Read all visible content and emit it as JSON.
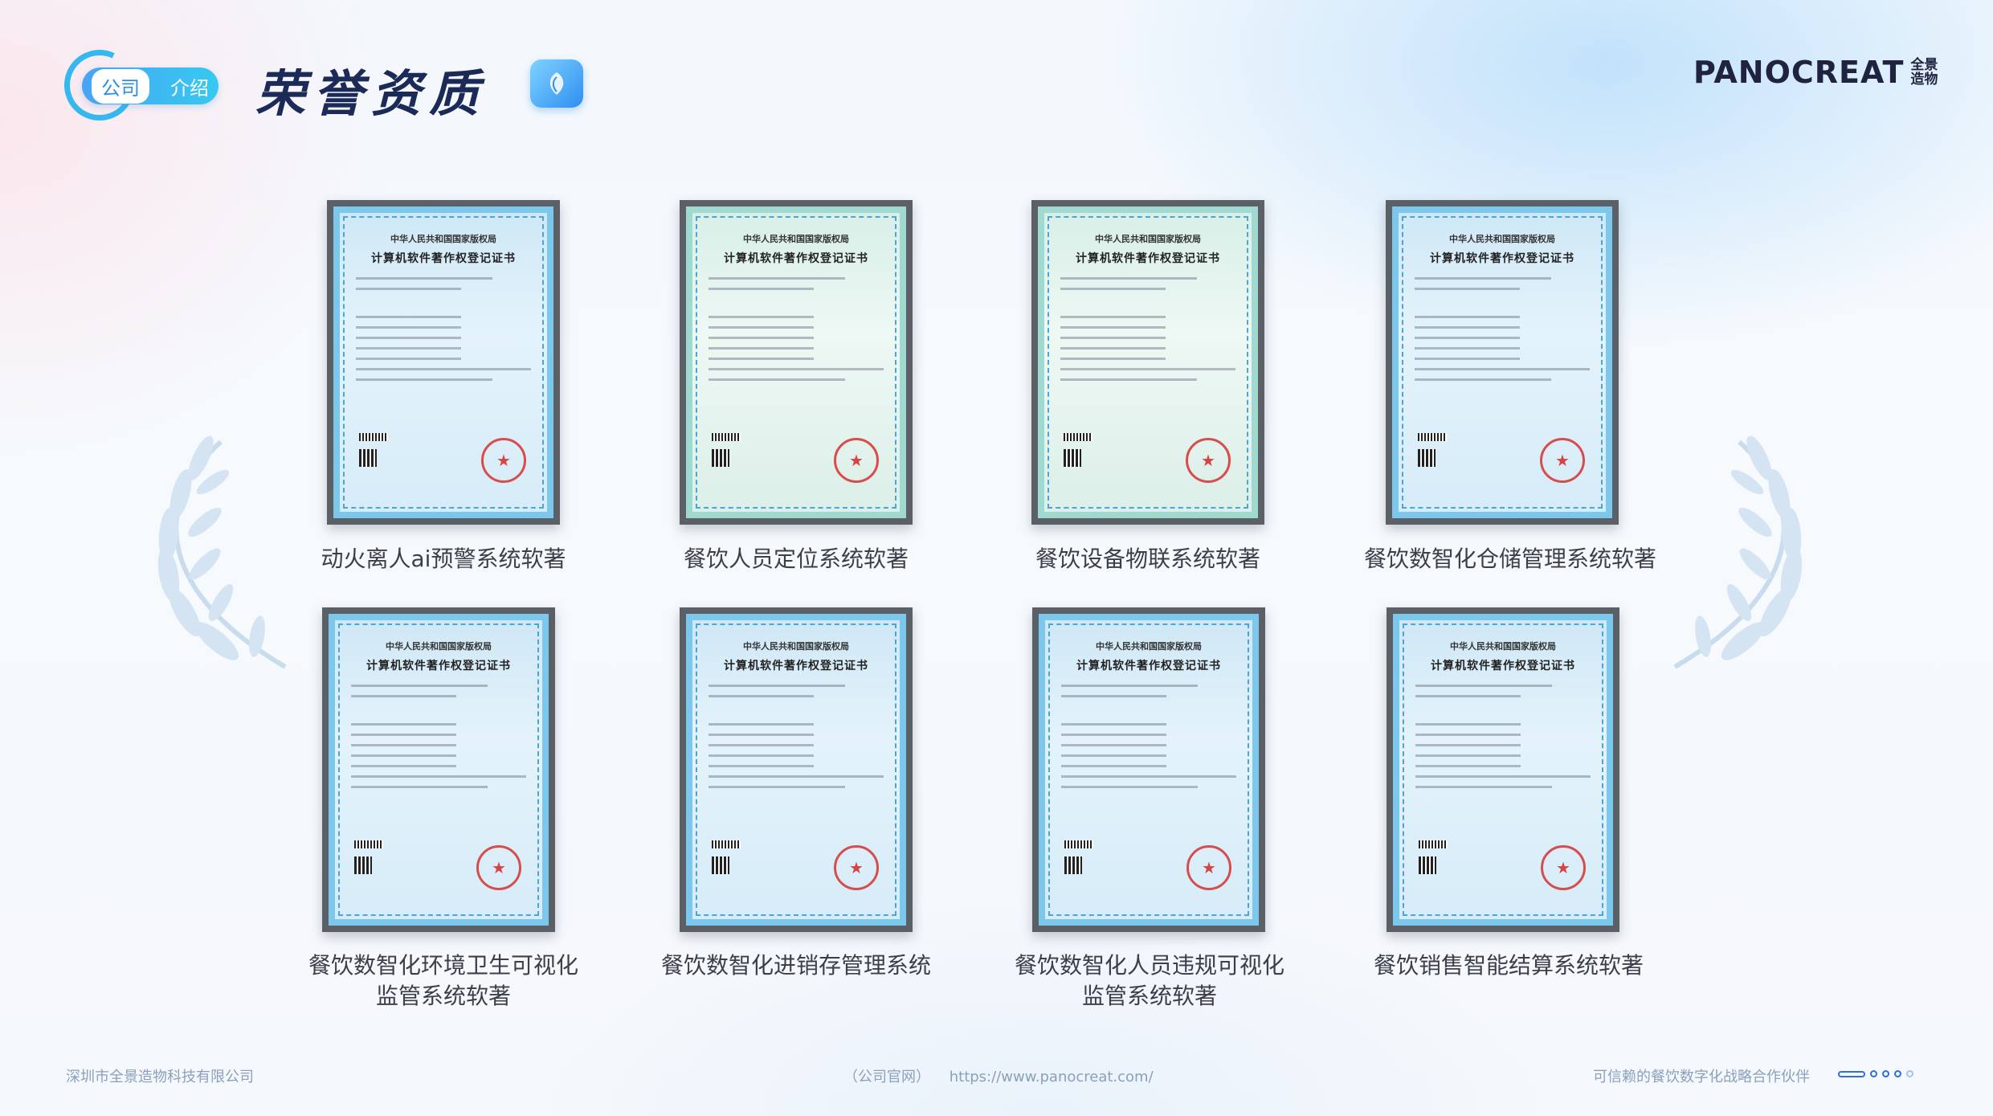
{
  "header": {
    "badge_left": "公司",
    "badge_right": "介绍",
    "title": "荣誉资质",
    "brand_name": "PANOCREAT",
    "brand_sub_1": "全景",
    "brand_sub_2": "造物"
  },
  "certificate_template": {
    "issuer": "中华人民共和国国家版权局",
    "heading": "计算机软件著作权登记证书"
  },
  "certificates": [
    {
      "caption": "动火离人ai预警系统软著"
    },
    {
      "caption": "餐饮人员定位系统软著"
    },
    {
      "caption": "餐饮设备物联系统软著"
    },
    {
      "caption": "餐饮数智化仓储管理系统软著"
    },
    {
      "caption_line1": "餐饮数智化环境卫生可视化",
      "caption_line2": "监管系统软著"
    },
    {
      "caption": "餐饮数智化进销存管理系统"
    },
    {
      "caption_line1": "餐饮数智化人员违规可视化",
      "caption_line2": "监管系统软著"
    },
    {
      "caption": "餐饮销售智能结算系统软著"
    }
  ],
  "footer": {
    "company": "深圳市全景造物科技有限公司",
    "website_label": "（公司官网）",
    "website_url": "https://www.panocreat.com/",
    "slogan": "可信赖的餐饮数字化战略合作伙伴"
  },
  "colors": {
    "accent": "#35b8ef",
    "title": "#1b2a57",
    "footer_text": "#8aa0bd",
    "pagination": "#2f6fd6"
  }
}
